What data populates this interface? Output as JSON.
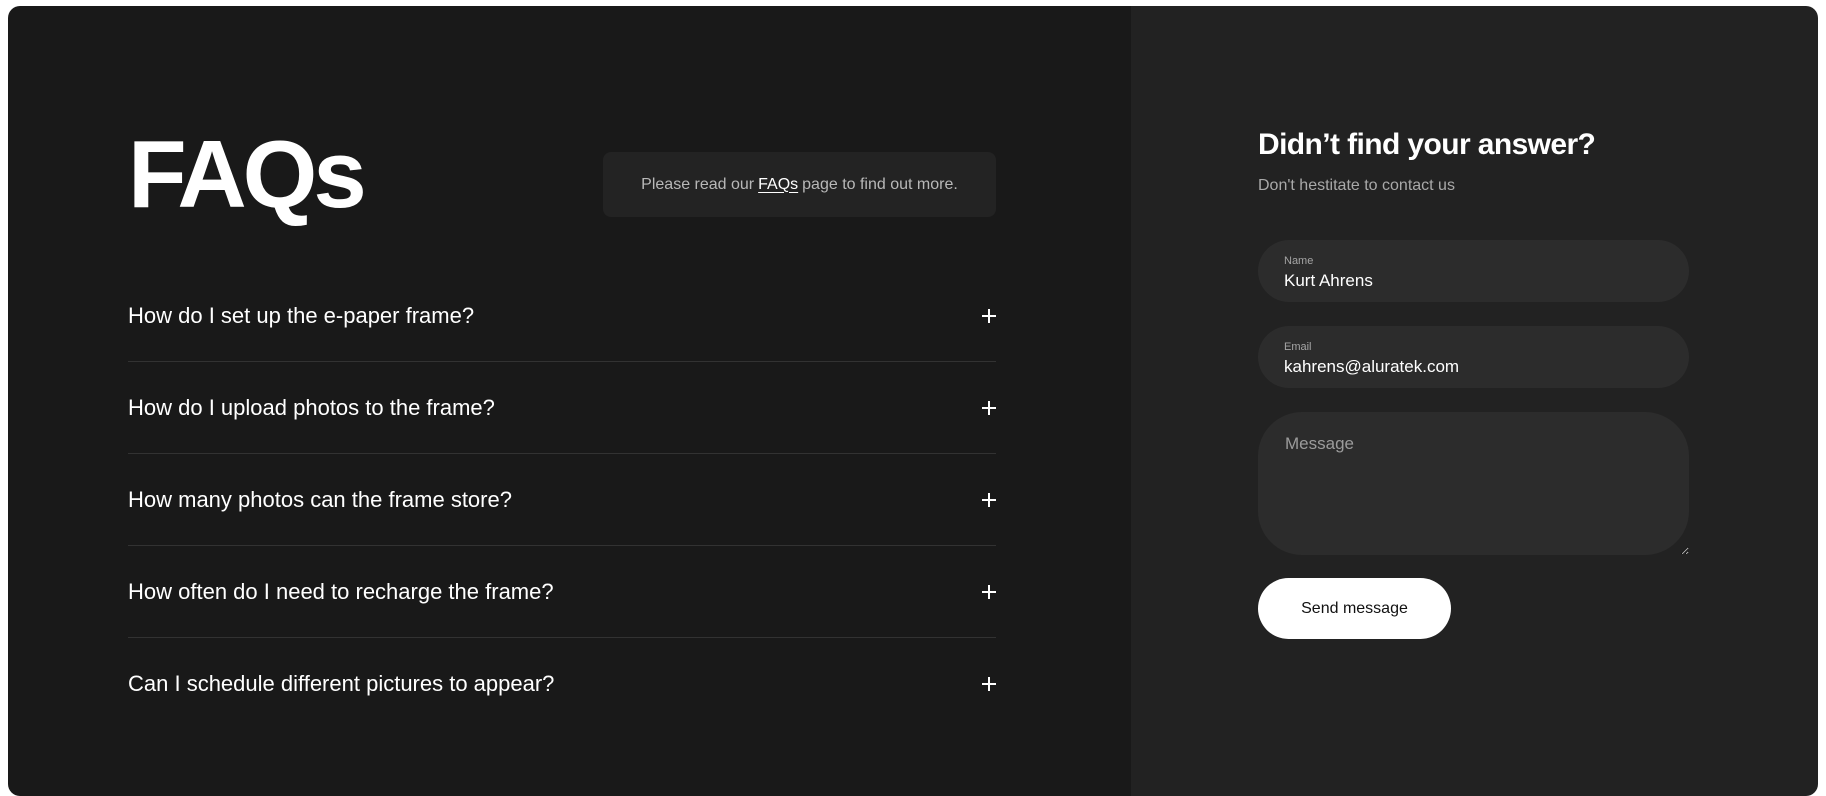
{
  "faq": {
    "title": "FAQs",
    "notice": {
      "before": "Please read our",
      "link": "FAQs",
      "after": "page to find out more."
    },
    "questions": [
      "How do I set up the e-paper frame?",
      "How do I upload photos to the frame?",
      "How many photos can the frame store?",
      "How often do I need to recharge the frame?",
      "Can I schedule different pictures to appear?"
    ],
    "expand_icon": "plus-icon"
  },
  "contact": {
    "title": "Didn’t find your answer?",
    "subtitle": "Don't hestitate to contact us",
    "name": {
      "label": "Name",
      "value": "Kurt Ahrens"
    },
    "email": {
      "label": "Email",
      "value": "kahrens@aluratek.com"
    },
    "message": {
      "placeholder": "Message"
    },
    "send_label": "Send message"
  },
  "colors": {
    "left_bg": "#191919",
    "right_bg": "#222222",
    "field_bg": "#2c2c2c",
    "button_bg": "#ffffff"
  }
}
